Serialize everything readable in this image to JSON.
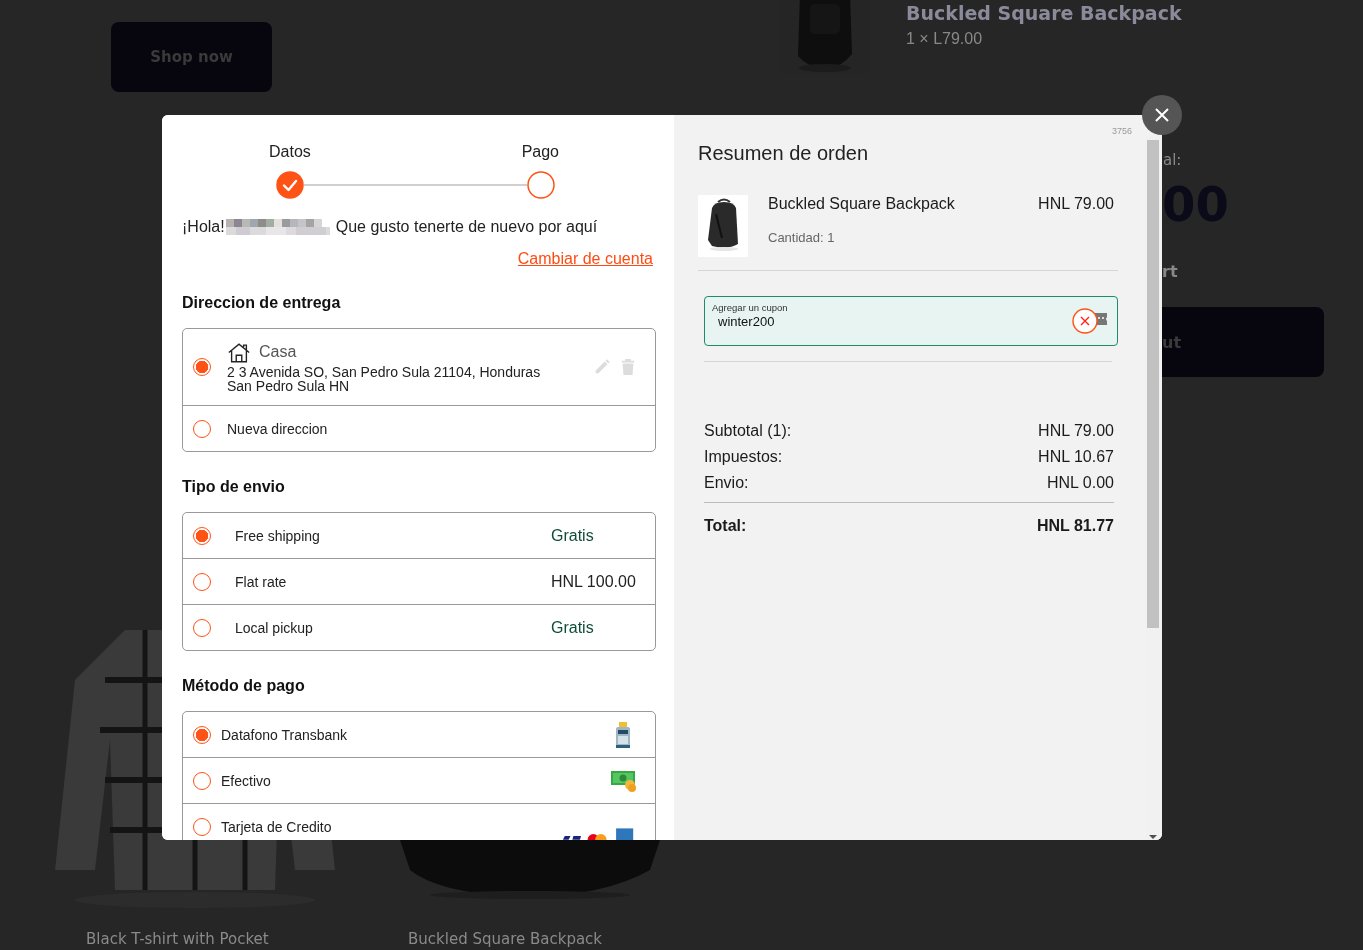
{
  "background": {
    "shop_button": "Shop now",
    "cart_item": {
      "title": "Buckled Square Backpack",
      "price": "1 × L79.00"
    },
    "fragments": [
      "al:",
      "00",
      "rt",
      "ut"
    ],
    "products": [
      {
        "name": "Black T-shirt with Pocket"
      },
      {
        "name": "Buckled Square Backpack"
      }
    ]
  },
  "checkout": {
    "steps": [
      {
        "label": "Datos",
        "done": true
      },
      {
        "label": "Pago",
        "done": false
      }
    ],
    "greeting": {
      "hello": "¡Hola!",
      "message": "Que gusto tenerte de nuevo por aquí"
    },
    "switch_account": "Cambiar de cuenta",
    "address": {
      "title": "Direccion de entrega",
      "options": [
        {
          "kind": "saved",
          "label": "Casa",
          "address": "2 3 Avenida SO, San Pedro Sula 21104, Honduras San Pedro Sula HN",
          "selected": true
        },
        {
          "kind": "new",
          "label": "Nueva direccion",
          "selected": false
        }
      ]
    },
    "shipping": {
      "title": "Tipo de envio",
      "options": [
        {
          "label": "Free shipping",
          "price": "Gratis",
          "free": true,
          "selected": true
        },
        {
          "label": "Flat rate",
          "price": "HNL 100.00",
          "free": false,
          "selected": false
        },
        {
          "label": "Local pickup",
          "price": "Gratis",
          "free": true,
          "selected": false
        }
      ]
    },
    "payment": {
      "title": "Método de pago",
      "options": [
        {
          "kind": "terminal",
          "label": "Datafono Transbank",
          "selected": true
        },
        {
          "kind": "cash",
          "label": "Efectivo",
          "selected": false
        },
        {
          "kind": "cards",
          "label": "Tarjeta de Credito",
          "selected": false
        }
      ]
    }
  },
  "summary": {
    "code": "3756",
    "title": "Resumen de orden",
    "items": [
      {
        "name": "Buckled Square Backpack",
        "price": "HNL 79.00",
        "quantity": "Cantidad: 1"
      }
    ],
    "coupon": {
      "label": "Agregar un cupon",
      "value": "winter200"
    },
    "totals": [
      {
        "label": "Subtotal (1):",
        "value": "HNL 79.00"
      },
      {
        "label": "Impuestos:",
        "value": "HNL 10.67"
      },
      {
        "label": "Envio:",
        "value": "HNL 0.00"
      }
    ],
    "total": {
      "label": "Total:",
      "value": "HNL 81.77"
    }
  }
}
